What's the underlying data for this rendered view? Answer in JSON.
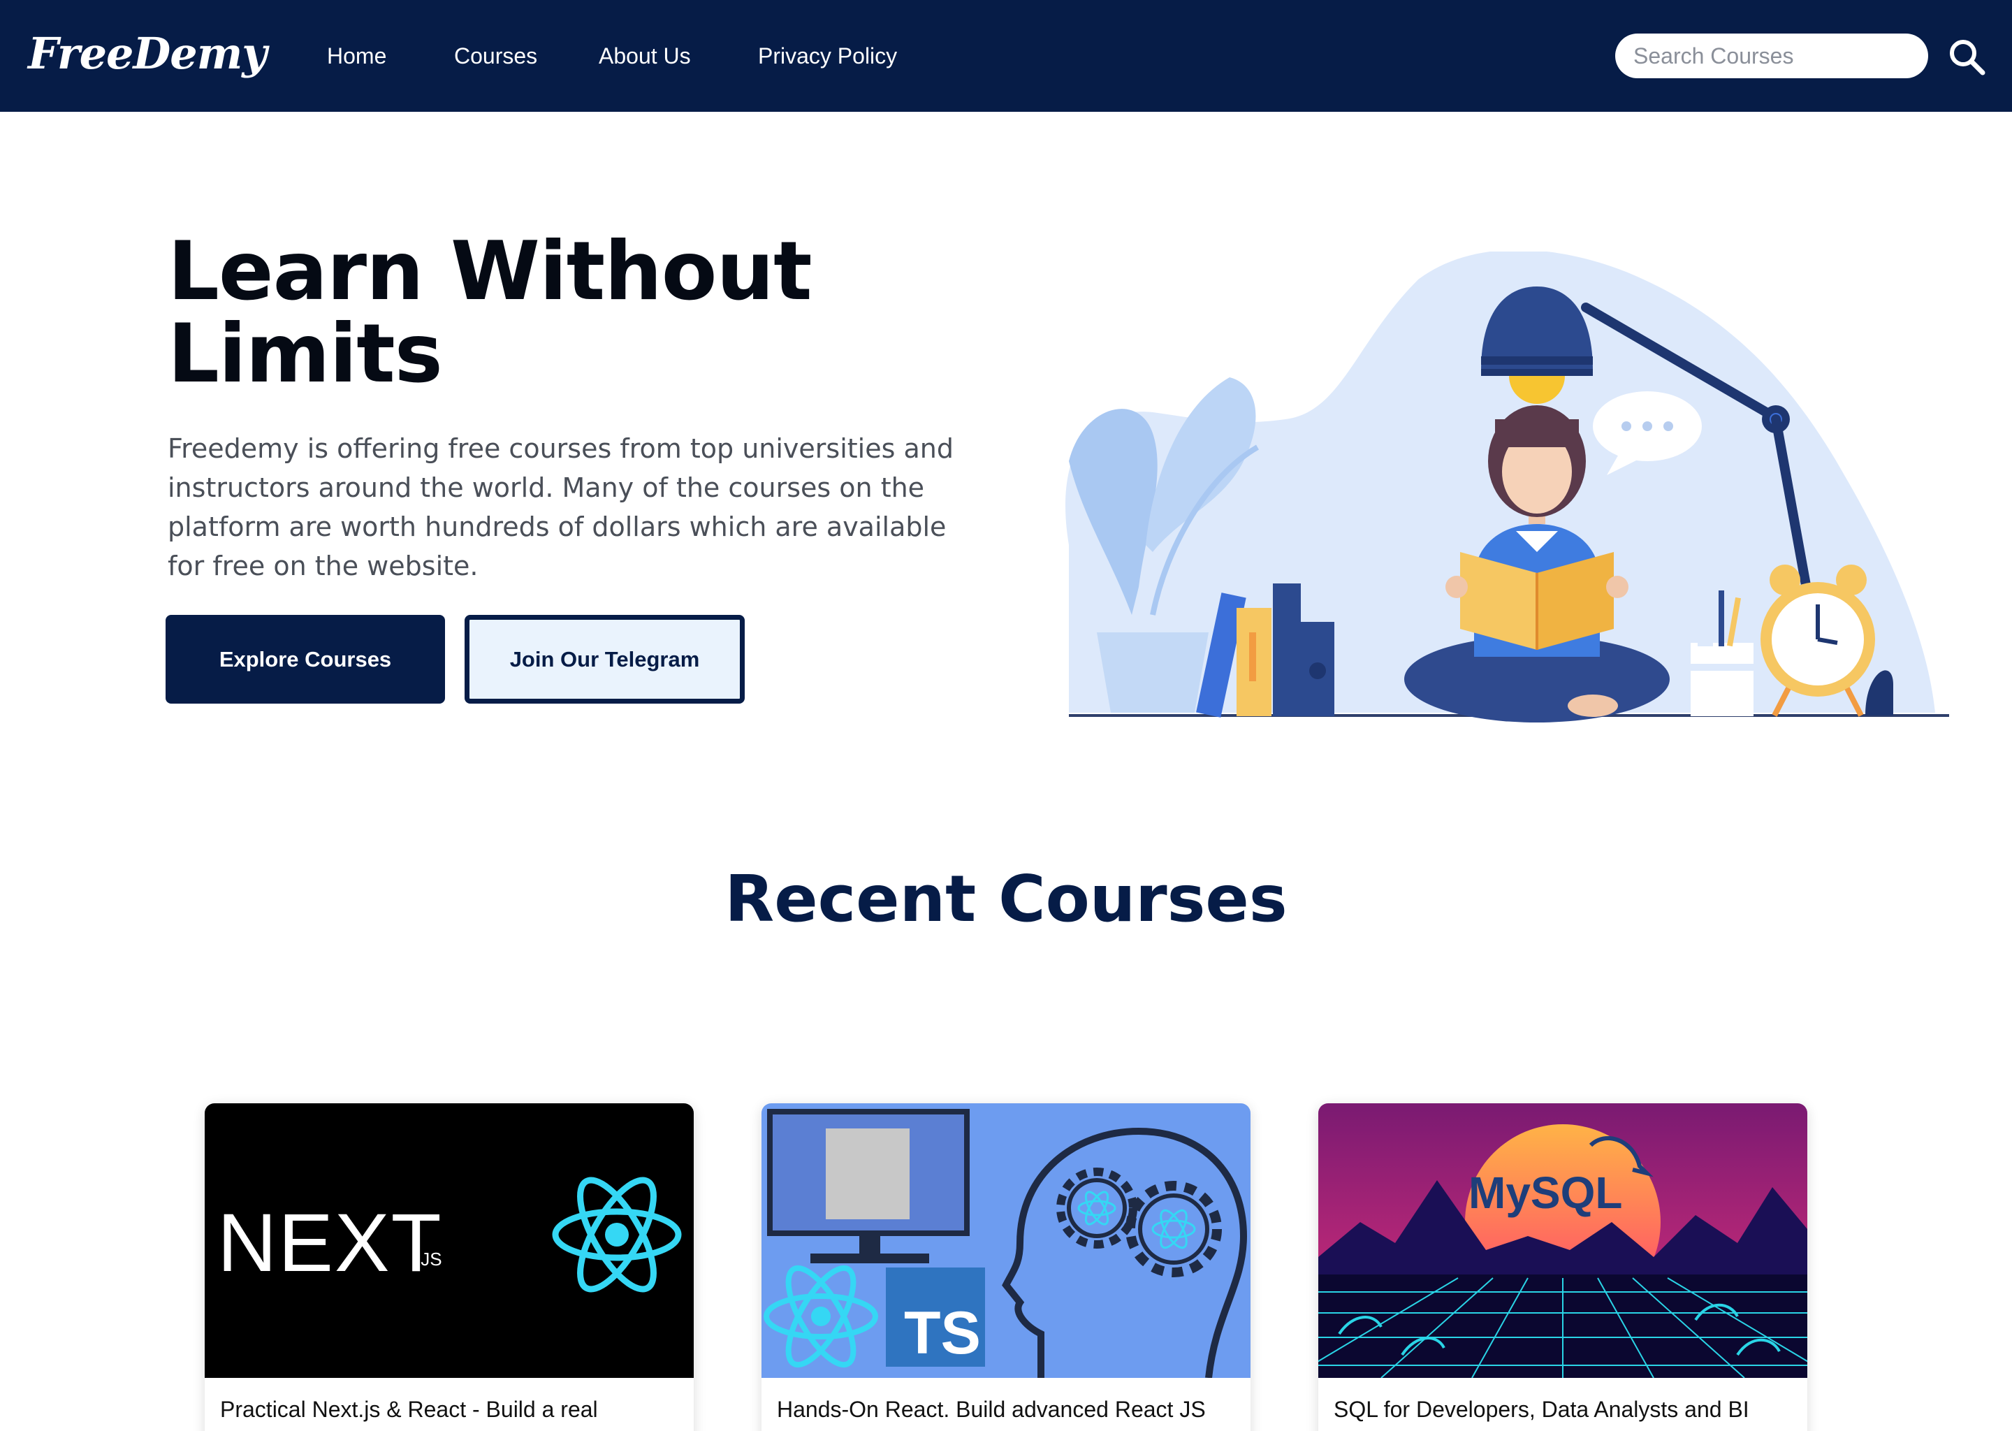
{
  "navbar": {
    "logo_text": "FreeDemy",
    "links": [
      "Home",
      "Courses",
      "About Us",
      "Privacy Policy"
    ],
    "search_placeholder": "Search Courses",
    "search_icon": "magnifier-icon"
  },
  "hero": {
    "title": "Learn Without Limits",
    "description": "Freedemy is offering free courses from top universities and instructors around the world. Many of the courses on the platform are worth hundreds of dollars which are available for free on the website.",
    "primary_button": "Explore Courses",
    "secondary_button": "Join Our Telegram",
    "illustration": "girl-reading-book-illustration"
  },
  "recent": {
    "title": "Recent Courses",
    "courses": [
      {
        "title": "Practical Next.js & React - Build a real",
        "thumb_text": "NEXT",
        "thumb_sub": ".JS"
      },
      {
        "title": "Hands-On React. Build advanced React JS",
        "thumb_text": "TS"
      },
      {
        "title": "SQL for Developers, Data Analysts and BI",
        "thumb_text": "MySQL"
      }
    ]
  },
  "colors": {
    "navy": "#061c47",
    "light_blue": "#dbe9fb",
    "accent_yellow": "#f7c35a",
    "react_cyan": "#35d7f4"
  }
}
